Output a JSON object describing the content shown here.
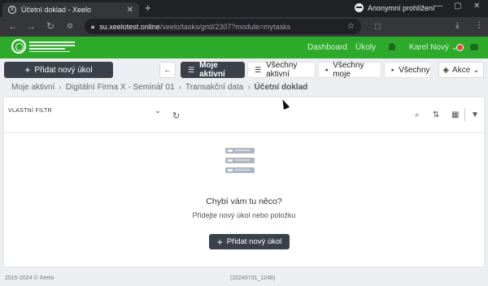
{
  "browser": {
    "tab_title": "Účetní doklad - Xeelo",
    "favicon": "X",
    "incognito_label": "Anonymní prohlížení",
    "url_host": "su.xeelotest.online",
    "url_path": "/xeelo/tasks/grid/2307?module=mytasks"
  },
  "app": {
    "brand_color": "#2eaa2b",
    "dark_color": "#3a414a",
    "nav": {
      "dashboard": "Dashboard",
      "tasks": "Úkoly"
    },
    "user_name": "Karel Nový"
  },
  "toolbar": {
    "add_task": "Přidat nový úkol",
    "views": [
      {
        "label": "Moje aktivní",
        "icon": "list-check-icon",
        "active": true
      },
      {
        "label": "Všechny aktivní",
        "icon": "list-icon",
        "active": false
      },
      {
        "label": "Všechny moje",
        "icon": "archive-icon",
        "active": false
      },
      {
        "label": "Všechny",
        "icon": "archive-icon",
        "active": false
      }
    ],
    "actions": "Akce"
  },
  "breadcrumb": [
    "Moje aktivní",
    "Digitální Firma X - Seminář 01",
    "Transakční data",
    "Účetní doklad"
  ],
  "panel": {
    "filter_label": "VLASTNÍ FILTR",
    "empty_title": "Chybí vám tu něco?",
    "empty_subtitle": "Přidejte nový úkol nebo položku",
    "empty_button": "Přidat nový úkol"
  },
  "footer": {
    "copyright": "2015-2024 © Xeelo",
    "version": "(20240731_1248)"
  }
}
